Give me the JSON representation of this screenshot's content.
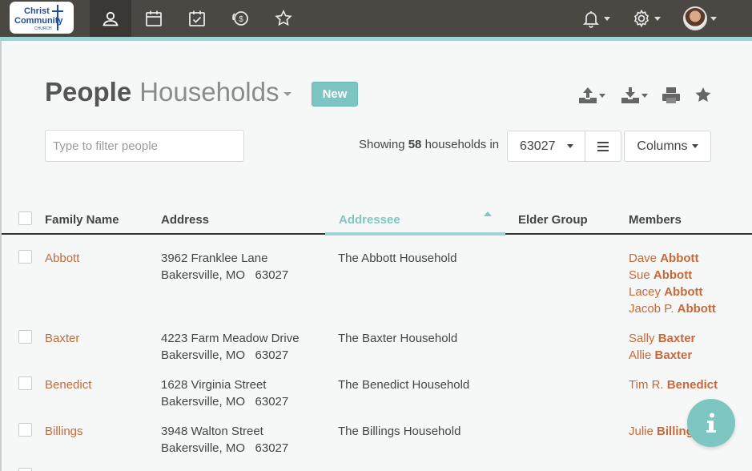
{
  "nav": {
    "logo": {
      "line1": "Christ",
      "line2": "Community",
      "line3": "CHURCH"
    },
    "icons": [
      "people-icon",
      "calendar-icon",
      "tasks-icon",
      "giving-icon",
      "star-icon"
    ],
    "right_icons": [
      "bell-icon",
      "gear-icon",
      "avatar"
    ]
  },
  "header": {
    "title": "People",
    "subtitle": "Households",
    "new_label": "New"
  },
  "toolbar": {
    "tools": [
      "upload-icon",
      "download-icon",
      "print-icon",
      "favorite-star-icon"
    ]
  },
  "filter": {
    "placeholder": "Type to filter people"
  },
  "summary": {
    "prefix": "Showing",
    "count": "58",
    "suffix": "households in",
    "zip": "63027",
    "columns_label": "Columns"
  },
  "table": {
    "headers": [
      "Family Name",
      "Address",
      "Addressee",
      "Elder Group",
      "Members"
    ],
    "sorted_column": "Addressee",
    "rows": [
      {
        "family": "Abbott",
        "addr1": "3962 Franklee Lane",
        "addr2": "Bakersville, MO   63027",
        "addressee": "The Abbott Household",
        "elder": "",
        "members": [
          {
            "first": "Dave",
            "last": "Abbott"
          },
          {
            "first": "Sue",
            "last": "Abbott"
          },
          {
            "first": "Lacey",
            "last": "Abbott"
          },
          {
            "first": "Jacob P.",
            "last": "Abbott"
          }
        ]
      },
      {
        "family": "Baxter",
        "addr1": "4223 Farm Meadow Drive",
        "addr2": "Bakersville, MO   63027",
        "addressee": "The Baxter Household",
        "elder": "",
        "members": [
          {
            "first": "Sally",
            "last": "Baxter"
          },
          {
            "first": "Allie",
            "last": "Baxter"
          }
        ]
      },
      {
        "family": "Benedict",
        "addr1": "1628 Virginia Street",
        "addr2": "Bakersville, MO   63027",
        "addressee": "The Benedict Household",
        "elder": "",
        "members": [
          {
            "first": "Tim R.",
            "last": "Benedict"
          }
        ]
      },
      {
        "family": "Billings",
        "addr1": "3948 Walton Street",
        "addr2": "Bakersville, MO   63027",
        "addressee": "The Billings Household",
        "elder": "",
        "members": [
          {
            "first": "Julie",
            "last": "Billings"
          }
        ]
      }
    ]
  },
  "colors": {
    "topbar": "#4b4743",
    "accent": "#7ec6c2",
    "link": "#c7693a"
  }
}
